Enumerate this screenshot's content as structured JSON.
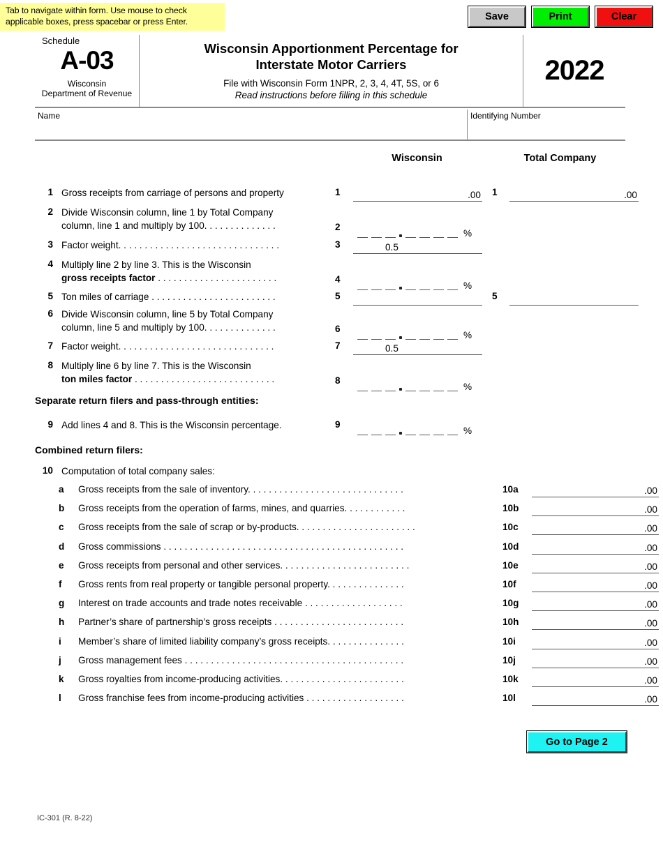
{
  "toolbar": {
    "tip": "Tab to navigate within form. Use mouse to check applicable boxes, press spacebar or press Enter.",
    "save_label": "Save",
    "print_label": "Print",
    "clear_label": "Clear",
    "save_color": "#c8c8c8",
    "print_color": "#00ee00",
    "clear_color": "#f01010",
    "tip_bg": "#ffff99"
  },
  "masthead": {
    "schedule_word": "Schedule",
    "schedule_code": "A-03",
    "agency_line1": "Wisconsin",
    "agency_line2": "Department of Revenue",
    "title_line1": "Wisconsin Apportionment Percentage for",
    "title_line2": "Interstate Motor Carriers",
    "subtitle1": "File with Wisconsin Form 1NPR, 2, 3, 4, 4T, 5S, or 6",
    "subtitle2": "Read instructions before filling in this schedule",
    "year": "2022"
  },
  "identity": {
    "name_label": "Name",
    "name_value": "",
    "id_label": "Identifying Number",
    "id_value": ""
  },
  "columns": {
    "wisconsin": "Wisconsin",
    "total_company": "Total Company"
  },
  "lines": [
    {
      "num": "1",
      "text": "Gross receipts from carriage of persons and property",
      "field_num": "1",
      "wi_type": "money",
      "wi_suffix": ".00",
      "wi_value": "",
      "tc_num": "1",
      "tc_type": "money",
      "tc_suffix": ".00",
      "tc_value": ""
    },
    {
      "num": "2",
      "text_line1": "Divide Wisconsin column, line 1 by Total Company",
      "text_line2": "column, line 1 and multiply by 100. . . . . . . . . . . . . .",
      "field_num": "2",
      "wi_type": "percent",
      "wi_value": "",
      "pct_sign": "%"
    },
    {
      "num": "3",
      "text": "Factor weight. . . . . . . . . . . . . . . . . . . . . . . . . . . . . . .",
      "field_num": "3",
      "wi_type": "money",
      "wi_value": "0.5"
    },
    {
      "num": "4",
      "text_line1": "Multiply line 2 by line 3. This is the Wisconsin",
      "text_line2_bold": "gross receipts factor",
      "text_line2_rest": " . . . . . . . . . . . . . . . . . . . . . . .",
      "field_num": "4",
      "wi_type": "percent",
      "wi_value": "",
      "pct_sign": "%"
    },
    {
      "num": "5",
      "text": "Ton miles of carriage . . . . . . . . . . . . . . . . . . . . . . . .",
      "field_num": "5",
      "wi_type": "money",
      "wi_value": "",
      "tc_num": "5",
      "tc_type": "money",
      "tc_value": ""
    },
    {
      "num": "6",
      "text_line1": "Divide Wisconsin column, line 5 by Total Company",
      "text_line2": "column, line 5 and multiply by 100. . . . . . . . . . . . . .",
      "field_num": "6",
      "wi_type": "percent",
      "wi_value": "",
      "pct_sign": "%"
    },
    {
      "num": "7",
      "text": "Factor weight. . . . . . . . . . . . . . . . . . . . . . . . . . . . . .",
      "field_num": "7",
      "wi_type": "money",
      "wi_value": "0.5"
    },
    {
      "num": "8",
      "text_line1": "Multiply line 6 by line 7. This is the Wisconsin",
      "text_line2_bold": "ton miles factor",
      "text_line2_rest": " . . . . . . . . . . . . . . . . . . . . . . . . . . .",
      "field_num": "8",
      "wi_type": "percent",
      "wi_value": "",
      "pct_sign": "%"
    },
    {
      "num": "9",
      "text": "Add lines 4 and 8. This is the Wisconsin percentage.",
      "field_num": "9",
      "wi_type": "percent",
      "wi_value": "",
      "pct_sign": "%"
    }
  ],
  "sections": {
    "separate_filers": "Separate return filers and pass-through entities:",
    "combined_filers": "Combined return filers:"
  },
  "line10": {
    "num": "10",
    "heading": "Computation of total company sales:",
    "items": [
      {
        "letter": "a",
        "text": "Gross receipts from the sale of inventory. . . . . . . . . . . . . . . . . . . . . . . . . . . . . .",
        "code": "10a",
        "suffix": ".00",
        "value": ""
      },
      {
        "letter": "b",
        "text": "Gross receipts from the operation of farms, mines, and quarries. . . . . . . . . . . .",
        "code": "10b",
        "suffix": ".00",
        "value": ""
      },
      {
        "letter": "c",
        "text": "Gross receipts from the sale of scrap or by-products. . . . . . . . . . . . . . . . . . . . . . .",
        "code": "10c",
        "suffix": ".00",
        "value": ""
      },
      {
        "letter": "d",
        "text": "Gross commissions . . . . . . . . . . . . . . . . . . . . . . . . . . . . . . . . . . . . . . . . . . . . . .",
        "code": "10d",
        "suffix": ".00",
        "value": ""
      },
      {
        "letter": "e",
        "text": "Gross receipts from personal and other services. . . . . . . . . . . . . . . . . . . . . . . . .",
        "code": "10e",
        "suffix": ".00",
        "value": ""
      },
      {
        "letter": "f",
        "text": "Gross rents from real property or tangible personal property. . . . . . . . . . . . . . .",
        "code": "10f",
        "suffix": ".00",
        "value": ""
      },
      {
        "letter": "g",
        "text": "Interest on trade accounts and trade notes receivable  . . . . . . . . . . . . . . . . . . .",
        "code": "10g",
        "suffix": ".00",
        "value": ""
      },
      {
        "letter": "h",
        "text": "Partner’s share of partnership’s gross receipts . . . . . . . . . . . . . . . . . . . . . . . . .",
        "code": "10h",
        "suffix": ".00",
        "value": ""
      },
      {
        "letter": "i",
        "text": "Member’s share of limited liability company’s gross receipts. . . . . . . . . . . . . . .",
        "code": "10i",
        "suffix": ".00",
        "value": ""
      },
      {
        "letter": "j",
        "text": "Gross management fees . . . . . . . . . . . . . . . . . . . . . . . . . . . . . . . . . . . . . . . . . .",
        "code": "10j",
        "suffix": ".00",
        "value": ""
      },
      {
        "letter": "k",
        "text": "Gross royalties from income-producing activities. . . . . . . . . . . . . . . . . . . . . . . .",
        "code": "10k",
        "suffix": ".00",
        "value": ""
      },
      {
        "letter": "l",
        "text": "Gross franchise fees from income-producing activities . . . . . . . . . . . . . . . . . . .",
        "code": "10l",
        "suffix": ".00",
        "value": ""
      }
    ]
  },
  "footer": {
    "goto_label": "Go to Page 2",
    "goto_color": "#1ff2f2",
    "form_code": "IC-301 (R. 8-22)"
  }
}
